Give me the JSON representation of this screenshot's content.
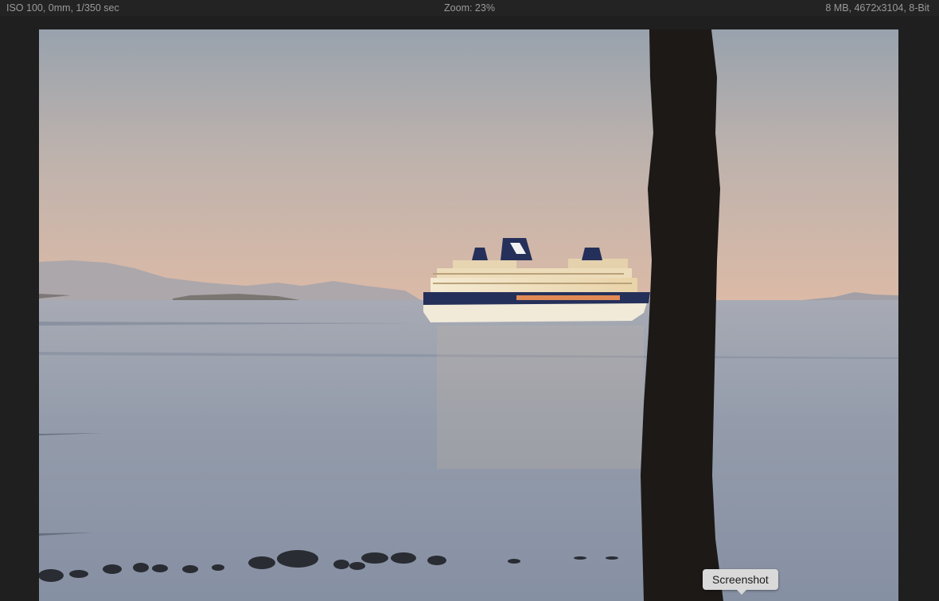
{
  "info_bar": {
    "exposure": "ISO 100, 0mm, 1/350 sec",
    "zoom": "Zoom: 23%",
    "file_info": "8 MB, 4672x3104, 8-Bit"
  },
  "tooltip": {
    "label": "Screenshot"
  },
  "photo": {
    "subject": "cruise-ship-at-sunset",
    "colors": {
      "sky_top": "#9aa3ad",
      "sky_bottom": "#d9b9a6",
      "water": "#8f98a8",
      "tree": "#1b1816",
      "ship_hull": "#24305c"
    }
  }
}
